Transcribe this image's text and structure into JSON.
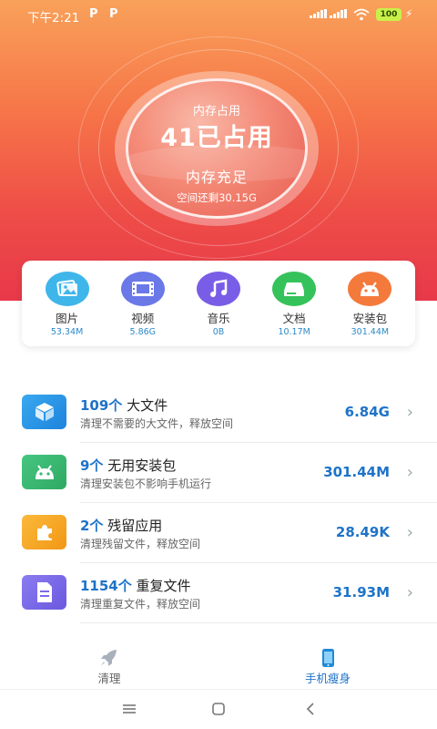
{
  "status_bar": {
    "time": "下午2:21",
    "battery": "100"
  },
  "memory": {
    "label": "内存占用",
    "value": "41已占用",
    "status": "内存充足",
    "remaining": "空间还剩30.15G"
  },
  "categories": [
    {
      "name": "图片",
      "size": "53.34M",
      "icon": "image-icon",
      "color": "#3fb6ea"
    },
    {
      "name": "视频",
      "size": "5.86G",
      "icon": "video-icon",
      "color": "#6b78e8"
    },
    {
      "name": "音乐",
      "size": "0B",
      "icon": "music-icon",
      "color": "#7a5de6"
    },
    {
      "name": "文档",
      "size": "10.17M",
      "icon": "document-icon",
      "color": "#35c25a"
    },
    {
      "name": "安装包",
      "size": "301.44M",
      "icon": "android-icon",
      "color": "#f47a3c"
    }
  ],
  "items": [
    {
      "count": "109个",
      "title": "大文件",
      "subtitle": "清理不需要的大文件，释放空间",
      "size": "6.84G",
      "icon": "box-icon",
      "color": "#2f9ae8"
    },
    {
      "count": "9个",
      "title": "无用安装包",
      "subtitle": "清理安装包不影响手机运行",
      "size": "301.44M",
      "icon": "android-icon",
      "color": "#3ab872"
    },
    {
      "count": "2个",
      "title": "残留应用",
      "subtitle": "清理残留文件，释放空间",
      "size": "28.49K",
      "icon": "puzzle-icon",
      "color": "#f5a623"
    },
    {
      "count": "1154个",
      "title": "重复文件",
      "subtitle": "清理重复文件，释放空间",
      "size": "31.93M",
      "icon": "file-icon",
      "color": "#7b6be8"
    }
  ],
  "tabs": [
    {
      "label": "清理",
      "icon": "rocket-icon",
      "active": false
    },
    {
      "label": "手机瘦身",
      "icon": "phone-icon",
      "active": true
    }
  ],
  "colors": {
    "accent": "#1e73c8",
    "hero_top": "#f9a15a",
    "hero_bottom": "#e8384a"
  }
}
